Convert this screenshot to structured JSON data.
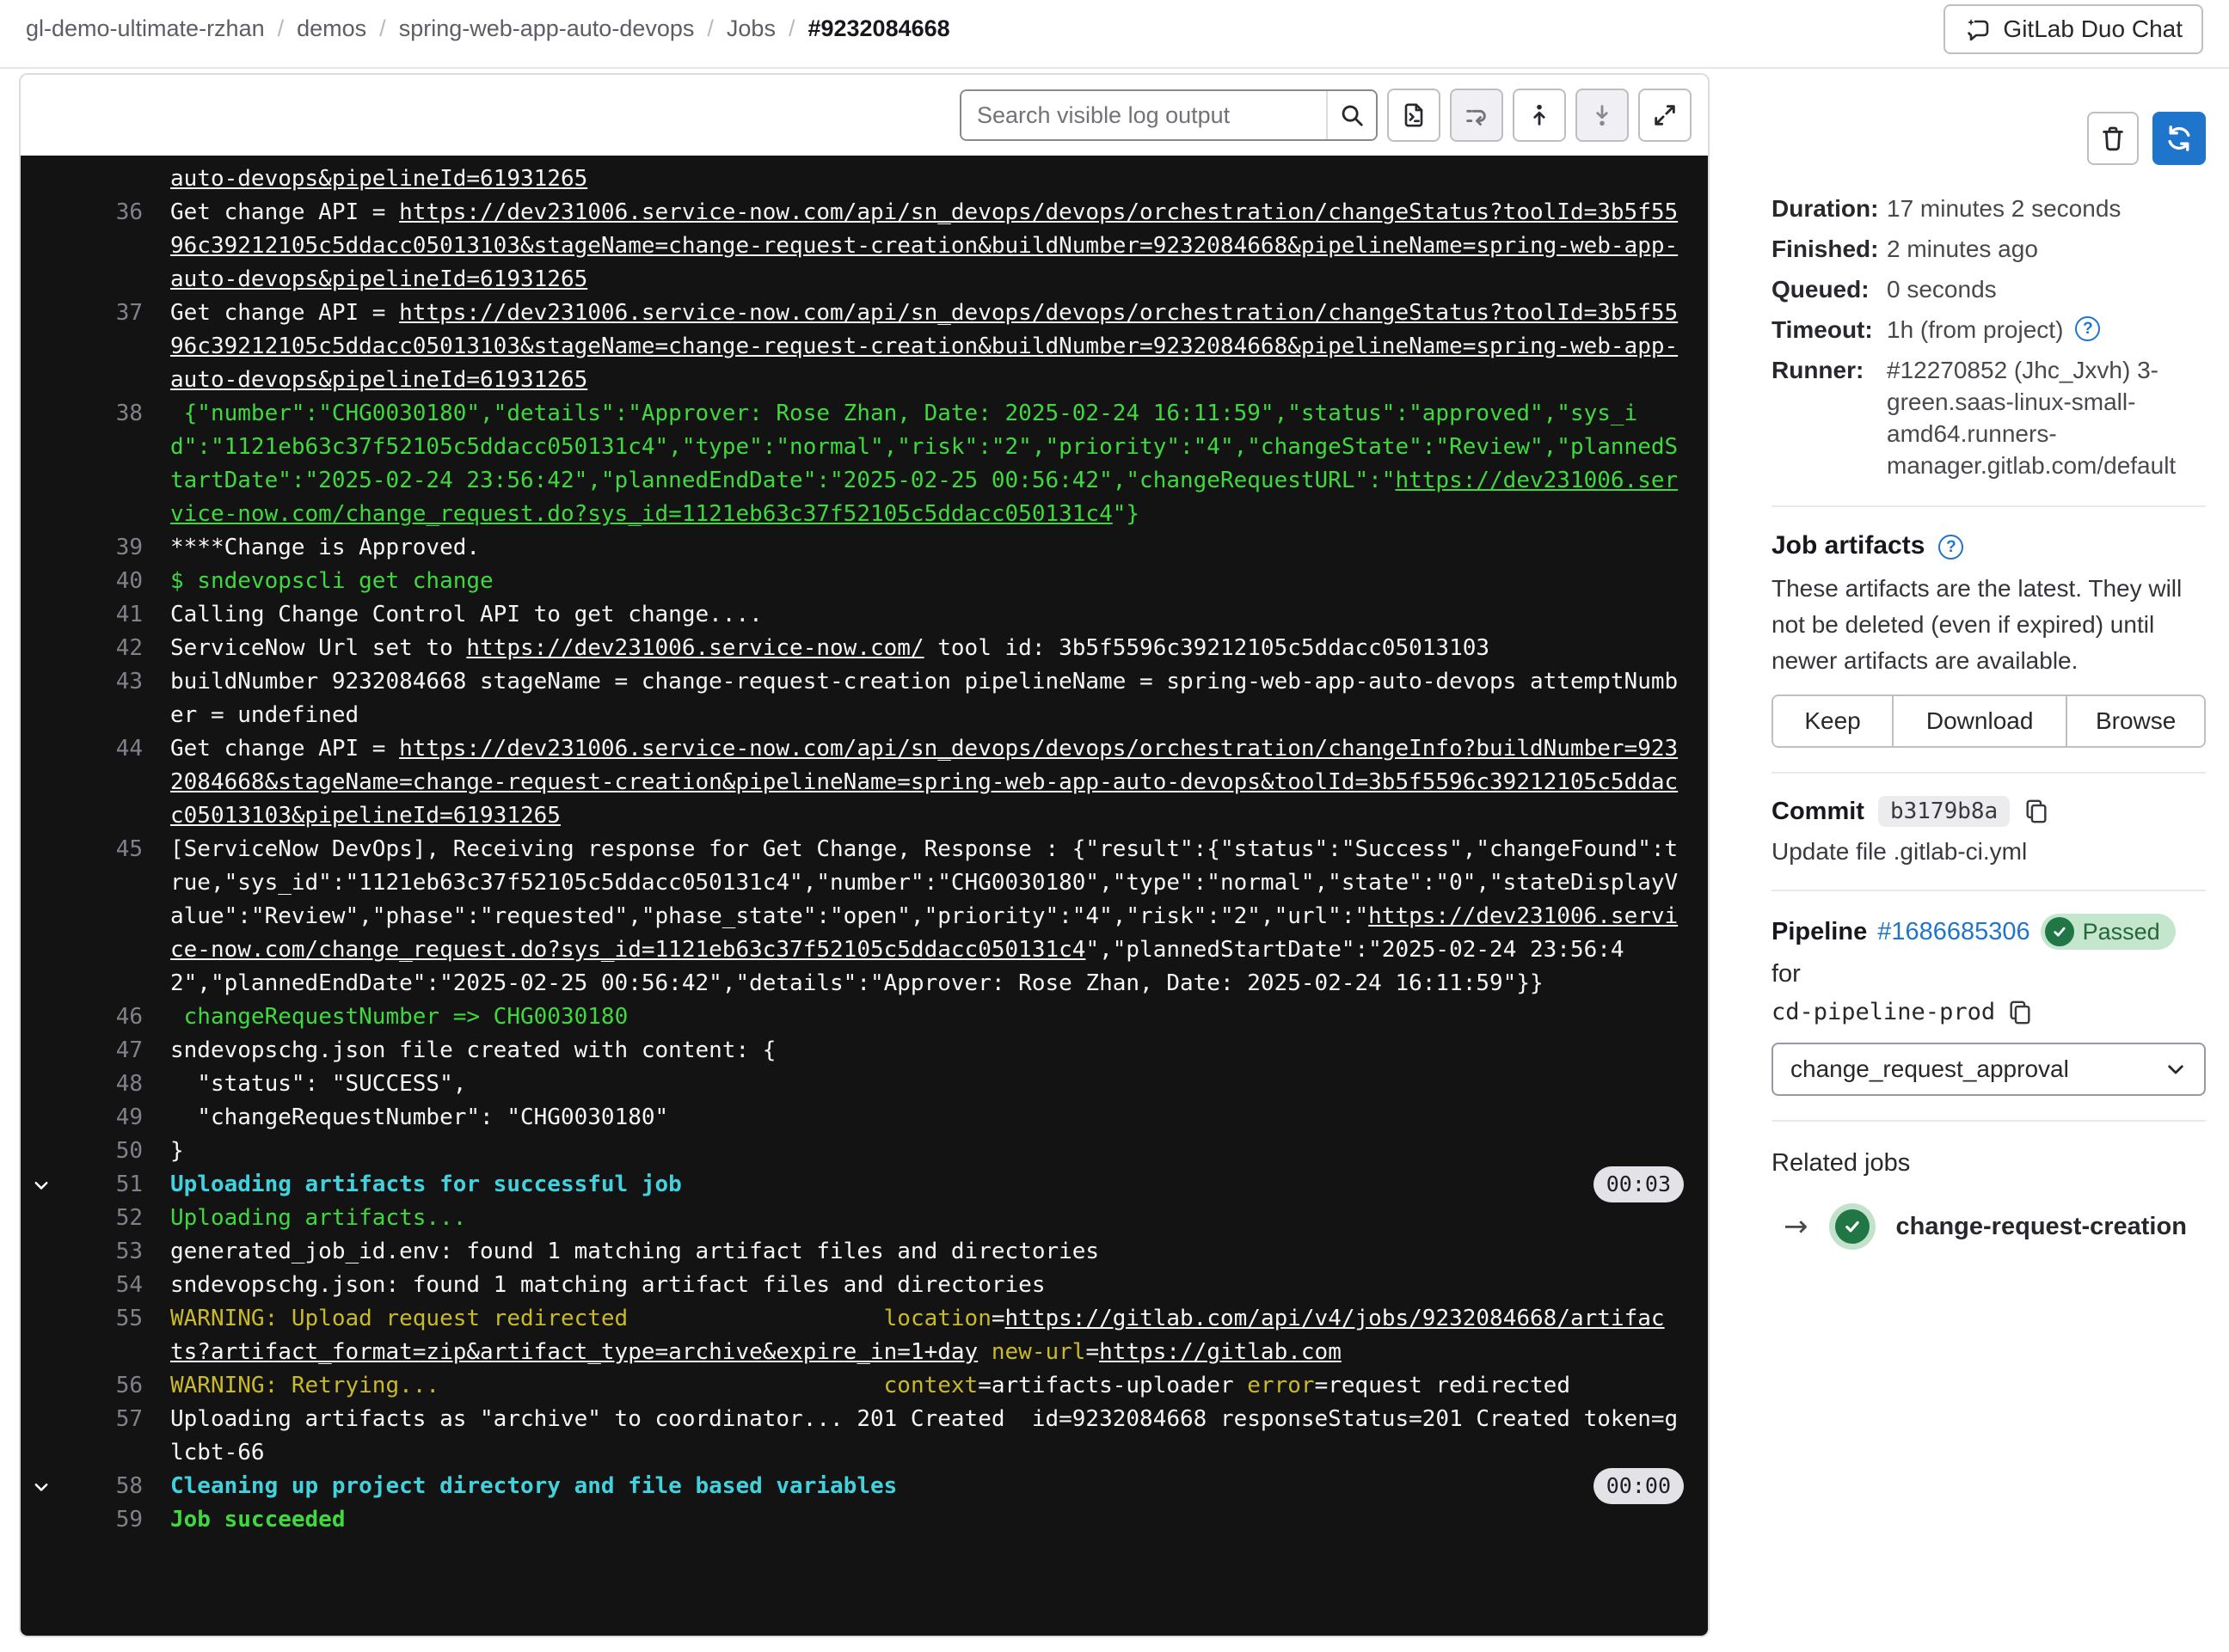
{
  "breadcrumb": {
    "items": [
      "gl-demo-ultimate-rzhan",
      "demos",
      "spring-web-app-auto-devops",
      "Jobs"
    ],
    "current": "#9232084668",
    "separator": "/"
  },
  "header": {
    "duo_chat_label": "GitLab Duo Chat"
  },
  "toolbar": {
    "search_placeholder": "Search visible log output",
    "icons": [
      "search-icon",
      "raw-log-icon",
      "wrap-lines-icon",
      "scroll-top-icon",
      "scroll-bottom-icon",
      "fullscreen-icon"
    ]
  },
  "colors": {
    "accent_blue": "#1f75cb",
    "success_green": "#217645",
    "log_green": "#3fd93f",
    "log_teal": "#41d2de",
    "log_yellow": "#c9ba29",
    "log_background": "#131313"
  },
  "log": {
    "lines": [
      {
        "num": "",
        "seg": [
          {
            "c": "l",
            "t": "auto-devops&pipelineId=61931265"
          }
        ]
      },
      {
        "num": "36",
        "seg": [
          {
            "c": "w",
            "t": "Get change API = "
          },
          {
            "c": "l",
            "t": "https://dev231006.service-now.com/api/sn_devops/devops/orchestration/changeStatus?toolId=3b5f5596c39212105c5ddacc05013103&stageName=change-request-creation&buildNumber=9232084668&pipelineName=spring-web-app-auto-devops&pipelineId=61931265"
          }
        ]
      },
      {
        "num": "37",
        "seg": [
          {
            "c": "w",
            "t": "Get change API = "
          },
          {
            "c": "l",
            "t": "https://dev231006.service-now.com/api/sn_devops/devops/orchestration/changeStatus?toolId=3b5f5596c39212105c5ddacc05013103&stageName=change-request-creation&buildNumber=9232084668&pipelineName=spring-web-app-auto-devops&pipelineId=61931265"
          }
        ]
      },
      {
        "num": "38",
        "seg": [
          {
            "c": "g",
            "t": " {\"number\":\"CHG0030180\",\"details\":\"Approver: Rose Zhan, Date: 2025-02-24 16:11:59\",\"status\":\"approved\",\"sys_id\":\"1121eb63c37f52105c5ddacc050131c4\",\"type\":\"normal\",\"risk\":\"2\",\"priority\":\"4\",\"changeState\":\"Review\",\"plannedStartDate\":\"2025-02-24 23:56:42\",\"plannedEndDate\":\"2025-02-25 00:56:42\",\"changeRequestURL\":\""
          },
          {
            "c": "gl",
            "t": "https://dev231006.service-now.com/change_request.do?sys_id=1121eb63c37f52105c5ddacc050131c4"
          },
          {
            "c": "g",
            "t": "\"}"
          }
        ]
      },
      {
        "num": "39",
        "seg": [
          {
            "c": "w",
            "t": "****Change is Approved."
          }
        ]
      },
      {
        "num": "40",
        "seg": [
          {
            "c": "g",
            "t": "$ sndevopscli get change"
          }
        ]
      },
      {
        "num": "41",
        "seg": [
          {
            "c": "w",
            "t": "Calling Change Control API to get change...."
          }
        ]
      },
      {
        "num": "42",
        "seg": [
          {
            "c": "w",
            "t": "ServiceNow Url set to "
          },
          {
            "c": "l",
            "t": "https://dev231006.service-now.com/"
          },
          {
            "c": "w",
            "t": " tool id: 3b5f5596c39212105c5ddacc05013103"
          }
        ]
      },
      {
        "num": "43",
        "seg": [
          {
            "c": "w",
            "t": "buildNumber 9232084668 stageName = change-request-creation pipelineName = spring-web-app-auto-devops attemptNumber = undefined"
          }
        ]
      },
      {
        "num": "44",
        "seg": [
          {
            "c": "w",
            "t": "Get change API = "
          },
          {
            "c": "l",
            "t": "https://dev231006.service-now.com/api/sn_devops/devops/orchestration/changeInfo?buildNumber=9232084668&stageName=change-request-creation&pipelineName=spring-web-app-auto-devops&toolId=3b5f5596c39212105c5ddacc05013103&pipelineId=61931265"
          }
        ]
      },
      {
        "num": "45",
        "seg": [
          {
            "c": "w",
            "t": "[ServiceNow DevOps], Receiving response for Get Change, Response : {\"result\":{\"status\":\"Success\",\"changeFound\":true,\"sys_id\":\"1121eb63c37f52105c5ddacc050131c4\",\"number\":\"CHG0030180\",\"type\":\"normal\",\"state\":\"0\",\"stateDisplayValue\":\"Review\",\"phase\":\"requested\",\"phase_state\":\"open\",\"priority\":\"4\",\"risk\":\"2\",\"url\":\""
          },
          {
            "c": "l",
            "t": "https://dev231006.service-now.com/change_request.do?sys_id=1121eb63c37f52105c5ddacc050131c4"
          },
          {
            "c": "w",
            "t": "\",\"plannedStartDate\":\"2025-02-24 23:56:42\",\"plannedEndDate\":\"2025-02-25 00:56:42\",\"details\":\"Approver: Rose Zhan, Date: 2025-02-24 16:11:59\"}}"
          }
        ]
      },
      {
        "num": "46",
        "seg": [
          {
            "c": "g",
            "t": " changeRequestNumber => CHG0030180"
          }
        ]
      },
      {
        "num": "47",
        "seg": [
          {
            "c": "w",
            "t": "sndevopschg.json file created with content: {"
          }
        ]
      },
      {
        "num": "48",
        "seg": [
          {
            "c": "w",
            "t": "  \"status\": \"SUCCESS\","
          }
        ]
      },
      {
        "num": "49",
        "seg": [
          {
            "c": "w",
            "t": "  \"changeRequestNumber\": \"CHG0030180\""
          }
        ]
      },
      {
        "num": "50",
        "seg": [
          {
            "c": "w",
            "t": "}"
          }
        ]
      },
      {
        "num": "51",
        "section": true,
        "badge": "00:03",
        "seg": [
          {
            "c": "sec",
            "t": "Uploading artifacts for successful job"
          }
        ]
      },
      {
        "num": "52",
        "seg": [
          {
            "c": "g",
            "t": "Uploading artifacts..."
          }
        ]
      },
      {
        "num": "53",
        "seg": [
          {
            "c": "w",
            "t": "generated_job_id.env: found 1 matching artifact files and directories"
          }
        ]
      },
      {
        "num": "54",
        "seg": [
          {
            "c": "w",
            "t": "sndevopschg.json: found 1 matching artifact files and directories"
          }
        ]
      },
      {
        "num": "55",
        "seg": [
          {
            "c": "y",
            "t": "WARNING: Upload request redirected"
          },
          {
            "c": "w",
            "t": "                   "
          },
          {
            "c": "y",
            "t": "location"
          },
          {
            "c": "w",
            "t": "="
          },
          {
            "c": "l",
            "t": "https://gitlab.com/api/v4/jobs/9232084668/artifacts?artifact_format=zip&artifact_type=archive&expire_in=1+day"
          },
          {
            "c": "w",
            "t": " "
          },
          {
            "c": "y",
            "t": "new-url"
          },
          {
            "c": "w",
            "t": "="
          },
          {
            "c": "l",
            "t": "https://gitlab.com"
          }
        ]
      },
      {
        "num": "56",
        "seg": [
          {
            "c": "y",
            "t": "WARNING: Retrying..."
          },
          {
            "c": "w",
            "t": "                                 "
          },
          {
            "c": "y",
            "t": "context"
          },
          {
            "c": "w",
            "t": "=artifacts-uploader "
          },
          {
            "c": "y",
            "t": "error"
          },
          {
            "c": "w",
            "t": "=request redirected"
          }
        ]
      },
      {
        "num": "57",
        "seg": [
          {
            "c": "w",
            "t": "Uploading artifacts as \"archive\" to coordinator... 201 Created  id=9232084668 responseStatus=201 Created token=glcbt-66"
          }
        ]
      },
      {
        "num": "58",
        "section": true,
        "badge": "00:00",
        "seg": [
          {
            "c": "sec",
            "t": "Cleaning up project directory and file based variables"
          }
        ]
      },
      {
        "num": "59",
        "seg": [
          {
            "c": "gb",
            "t": "Job succeeded"
          }
        ]
      }
    ]
  },
  "sidebar": {
    "details": [
      {
        "label": "Duration:",
        "value": "17 minutes 2 seconds"
      },
      {
        "label": "Finished:",
        "value": "2 minutes ago"
      },
      {
        "label": "Queued:",
        "value": "0 seconds"
      },
      {
        "label": "Timeout:",
        "value": "1h (from project)",
        "help": true
      },
      {
        "label": "Runner:",
        "value": "#12270852 (Jhc_Jxvh) 3-green.saas-linux-small-amd64.runners-manager.gitlab.com/default"
      }
    ],
    "artifacts": {
      "title": "Job artifacts",
      "description": "These artifacts are the latest. They will not be deleted (even if expired) until newer artifacts are available.",
      "buttons": [
        "Keep",
        "Download",
        "Browse"
      ]
    },
    "commit": {
      "label": "Commit",
      "sha": "b3179b8a",
      "message": "Update file .gitlab-ci.yml"
    },
    "pipeline": {
      "label": "Pipeline",
      "id": "#1686685306",
      "status": "Passed",
      "for_text": "for",
      "ref": "cd-pipeline-prod",
      "stage_dropdown": "change_request_approval"
    },
    "related_jobs": {
      "title": "Related jobs",
      "jobs": [
        {
          "name": "change-request-creation",
          "status": "passed"
        }
      ]
    }
  }
}
